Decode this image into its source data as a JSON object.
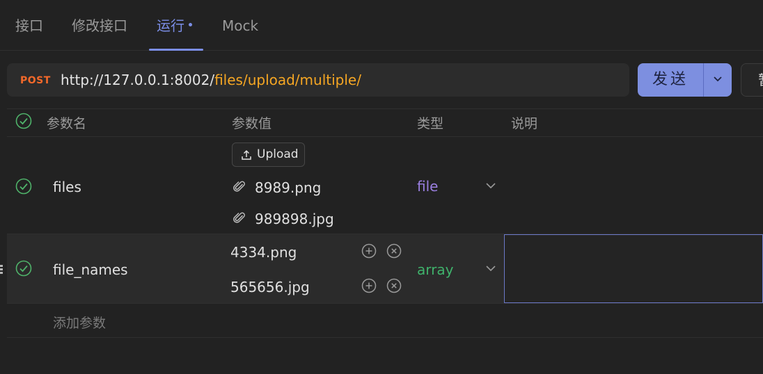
{
  "tabs": [
    {
      "label": "接口",
      "active": false
    },
    {
      "label": "修改接口",
      "active": false
    },
    {
      "label": "运行",
      "active": true,
      "modified": true
    },
    {
      "label": "Mock",
      "active": false
    }
  ],
  "request": {
    "method": "POST",
    "url_base": "http://127.0.0.1:8002/",
    "url_path": "files/upload/multiple/",
    "send_label": "发送",
    "save_label_partial": "暂"
  },
  "params_table": {
    "headers": {
      "name": "参数名",
      "value": "参数值",
      "type": "类型",
      "description": "说明"
    },
    "rows": [
      {
        "enabled": true,
        "name": "files",
        "upload_label": "Upload",
        "files": [
          "8989.png",
          "989898.jpg"
        ],
        "type": "file",
        "description": ""
      },
      {
        "enabled": true,
        "name": "file_names",
        "values": [
          "4334.png",
          "565656.jpg"
        ],
        "type": "array",
        "description": ""
      }
    ],
    "add_param_label": "添加参数"
  },
  "colors": {
    "accent": "#7b8ee6",
    "method_post": "#f5692a",
    "url_path": "#f5a623",
    "type_file": "#9a7fe0",
    "type_array": "#3fb26b",
    "check": "#4fb36a"
  }
}
